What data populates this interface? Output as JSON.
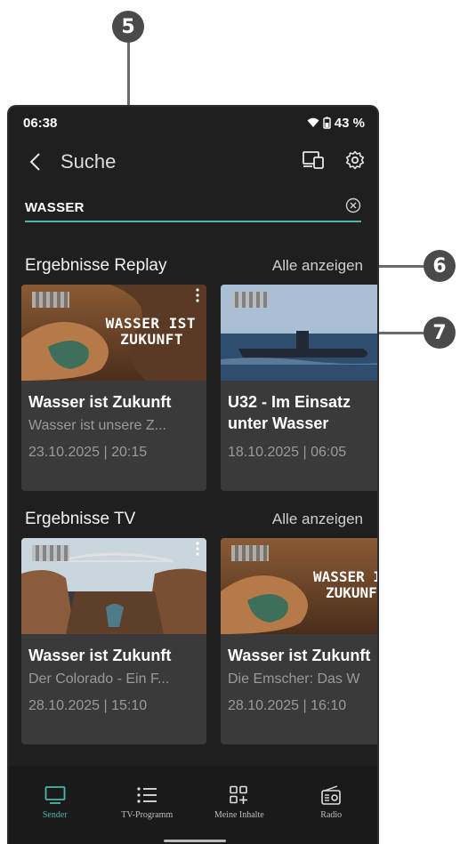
{
  "callouts": [
    "5",
    "6",
    "7"
  ],
  "status": {
    "time": "06:38",
    "battery": "43 %"
  },
  "header": {
    "title": "Suche"
  },
  "search": {
    "value": "WASSER"
  },
  "replay": {
    "title": "Ergebnisse Replay",
    "show_all": "Alle anzeigen",
    "cards": [
      {
        "thumb_text_1": "WASSER IST",
        "thumb_text_2": "ZUKUNFT",
        "title": "Wasser ist Zukunft",
        "subtitle": "Wasser ist unsere Z...",
        "date": "23.10.2025 | 20:15"
      },
      {
        "title_1": "U32 - Im Einsatz",
        "title_2": "unter Wasser",
        "date": "18.10.2025 | 06:05"
      }
    ]
  },
  "tv": {
    "title": "Ergebnisse TV",
    "show_all": "Alle anzeigen",
    "cards": [
      {
        "title": "Wasser ist Zukunft",
        "subtitle": "Der Colorado - Ein F...",
        "date": "28.10.2025 | 15:10"
      },
      {
        "thumb_text_1": "WASSER I",
        "thumb_text_2": "ZUKUNF",
        "title": "Wasser ist Zukunft",
        "subtitle": "Die Emscher: Das W",
        "date": "28.10.2025 | 16:10"
      }
    ]
  },
  "nav": [
    {
      "label": "Sender",
      "icon": "tv-icon",
      "active": true
    },
    {
      "label": "TV-Programm",
      "icon": "list-icon"
    },
    {
      "label": "Meine Inhalte",
      "icon": "grid-plus-icon"
    },
    {
      "label": "Radio",
      "icon": "radio-icon"
    }
  ],
  "colors": {
    "accent": "#4db6a8",
    "background": "#1f1f1f",
    "card": "#3a3a3a"
  }
}
